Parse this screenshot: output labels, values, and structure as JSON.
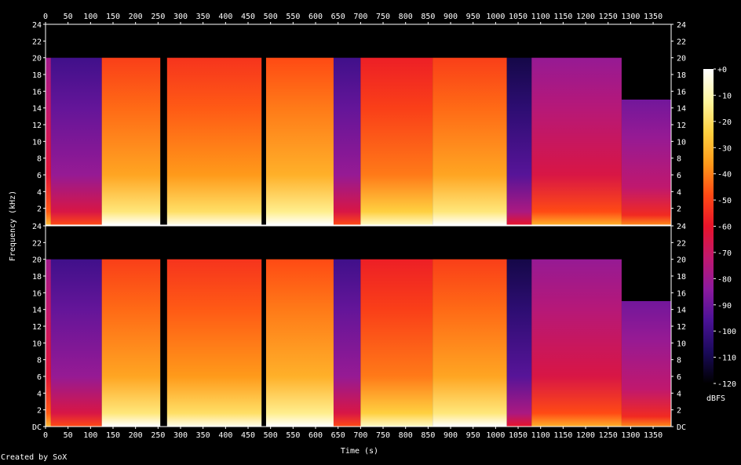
{
  "credit": "Created by SoX",
  "chart_data": {
    "type": "heatmap",
    "xlabel": "Time (s)",
    "ylabel": "Frequency (kHz)",
    "colorbar_label": "dBFS",
    "x_ticks": [
      "0",
      "50",
      "100",
      "150",
      "200",
      "250",
      "300",
      "350",
      "400",
      "450",
      "500",
      "550",
      "600",
      "650",
      "700",
      "750",
      "800",
      "850",
      "900",
      "950",
      "1000",
      "1050",
      "1100",
      "1150",
      "1200",
      "1250",
      "1300",
      "1350"
    ],
    "xlim": [
      0,
      1390
    ],
    "y_ticks_left": [
      "DC",
      "2",
      "4",
      "6",
      "8",
      "10",
      "12",
      "14",
      "16",
      "18",
      "20",
      "22",
      "24"
    ],
    "y_ticks_right": [
      "DC",
      "2",
      "4",
      "6",
      "8",
      "10",
      "12",
      "14",
      "16",
      "18",
      "20",
      "22",
      "24"
    ],
    "ylim_khz": [
      0,
      24
    ],
    "colorbar_ticks": [
      "+0",
      "-10",
      "-20",
      "-30",
      "-40",
      "-50",
      "-60",
      "-70",
      "-80",
      "-90",
      "-100",
      "-110",
      "-120"
    ],
    "colorbar_range_dbfs": [
      -120,
      0
    ],
    "channels": 2,
    "palette": [
      "#000000",
      "#1a0a5a",
      "#4a1296",
      "#8c1a9e",
      "#c0186e",
      "#e8142a",
      "#ff4a14",
      "#ff9a1a",
      "#ffd040",
      "#fff6a0",
      "#ffffff"
    ],
    "segments": [
      {
        "start": 0,
        "end": 12,
        "level": 0.46,
        "top_khz": 20
      },
      {
        "start": 12,
        "end": 125,
        "level": 0.3,
        "top_khz": 20
      },
      {
        "start": 125,
        "end": 255,
        "level": 0.7,
        "top_khz": 20
      },
      {
        "start": 255,
        "end": 270,
        "level": 0.05,
        "top_khz": 0
      },
      {
        "start": 270,
        "end": 480,
        "level": 0.68,
        "top_khz": 20
      },
      {
        "start": 480,
        "end": 490,
        "level": 0.05,
        "top_khz": 0
      },
      {
        "start": 490,
        "end": 640,
        "level": 0.72,
        "top_khz": 20
      },
      {
        "start": 640,
        "end": 700,
        "level": 0.3,
        "top_khz": 20
      },
      {
        "start": 700,
        "end": 860,
        "level": 0.64,
        "top_khz": 20
      },
      {
        "start": 860,
        "end": 1025,
        "level": 0.7,
        "top_khz": 20
      },
      {
        "start": 1025,
        "end": 1080,
        "level": 0.2,
        "top_khz": 20
      },
      {
        "start": 1080,
        "end": 1280,
        "level": 0.44,
        "top_khz": 20
      },
      {
        "start": 1280,
        "end": 1390,
        "level": 0.38,
        "top_khz": 15
      }
    ]
  }
}
